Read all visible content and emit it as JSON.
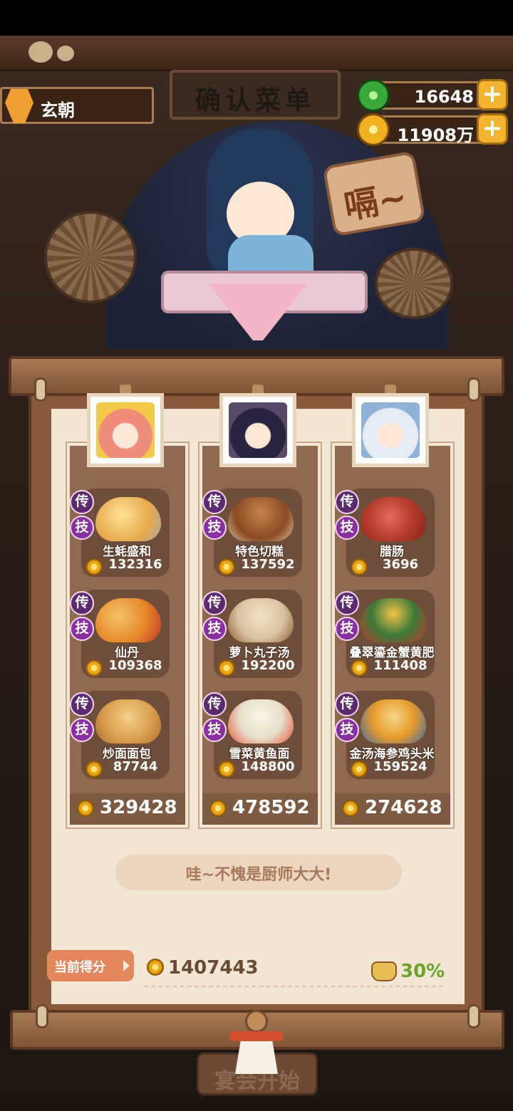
{
  "header": {
    "player_name": "玄朝",
    "sign_text": "确认菜单",
    "jade_amount": "16648",
    "coin_amount": "11908万",
    "plus_label": "+"
  },
  "speech_bubble": "嗝~",
  "tags": {
    "legend": "传",
    "skill": "技"
  },
  "columns": [
    {
      "total": "329428",
      "dishes": [
        {
          "name": "生蚝盛和",
          "value": "132316"
        },
        {
          "name": "仙丹",
          "value": "109368"
        },
        {
          "name": "炒面面包",
          "value": "87744"
        }
      ]
    },
    {
      "total": "478592",
      "dishes": [
        {
          "name": "特色切糕",
          "value": "137592"
        },
        {
          "name": "萝卜丸子汤",
          "value": "192200"
        },
        {
          "name": "雪菜黄鱼面",
          "value": "148800"
        }
      ]
    },
    {
      "total": "274628",
      "dishes": [
        {
          "name": "腊肠",
          "value": "3696"
        },
        {
          "name": "叠翠鎏金蟹黄肥",
          "value": "111408"
        },
        {
          "name": "金汤海参鸡头米",
          "value": "159524"
        }
      ]
    }
  ],
  "message": "哇~不愧是厨师大大!",
  "score": {
    "label": "当前得分",
    "value": "1407443",
    "bonus": "30%"
  },
  "start_button": "宴会开始",
  "colors": {
    "purple_tag": "#5d2a6f",
    "gold": "#e9a818",
    "green_bonus": "#6ba32c",
    "paper": "#f4e6d4"
  },
  "icons": [
    "jade-icon",
    "coin-icon",
    "plus-icon",
    "avatar-icon",
    "bonus-bag-icon"
  ]
}
